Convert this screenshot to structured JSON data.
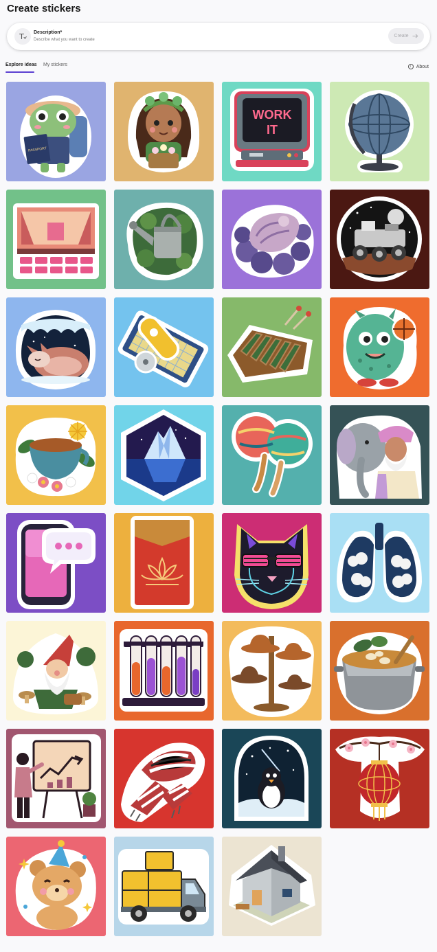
{
  "header": {
    "title": "Create stickers"
  },
  "prompt": {
    "label": "Description*",
    "placeholder": "Describe what you want to create",
    "create_label": "Create"
  },
  "tabs": [
    {
      "label": "Explore ideas",
      "active": true
    },
    {
      "label": "My stickers",
      "active": false
    }
  ],
  "about": {
    "label": "About"
  },
  "work_it_text": [
    "WORK",
    "IT"
  ],
  "passport_text": "PASSPORT",
  "stickers": [
    {
      "id": "frog-traveler",
      "bg": "#9aa5e2",
      "icon": "frog-traveler-icon"
    },
    {
      "id": "flower-girl",
      "bg": "#e0b46f",
      "icon": "flower-girl-icon"
    },
    {
      "id": "work-it-computer",
      "bg": "#6fd9c4",
      "icon": "retro-computer-icon"
    },
    {
      "id": "globe",
      "bg": "#cde9b4",
      "icon": "globe-icon"
    },
    {
      "id": "theater",
      "bg": "#72c189",
      "icon": "theater-icon"
    },
    {
      "id": "watering-can",
      "bg": "#6eb0ac",
      "icon": "watering-can-icon"
    },
    {
      "id": "seashell",
      "bg": "#9b72d9",
      "icon": "seashell-icon"
    },
    {
      "id": "moon-rover",
      "bg": "#4b1812",
      "icon": "moon-rover-icon"
    },
    {
      "id": "sleeping-fox",
      "bg": "#8eb6ee",
      "icon": "sleeping-fox-icon"
    },
    {
      "id": "rotary-cutter",
      "bg": "#74c3ee",
      "icon": "rotary-cutter-icon"
    },
    {
      "id": "xylophone",
      "bg": "#86b96a",
      "icon": "xylophone-icon"
    },
    {
      "id": "basketball-monster",
      "bg": "#ef6c2e",
      "icon": "monster-icon"
    },
    {
      "id": "tea-cup",
      "bg": "#f2c04a",
      "icon": "tea-cup-icon"
    },
    {
      "id": "iceberg",
      "bg": "#71d4e9",
      "icon": "iceberg-icon"
    },
    {
      "id": "maracas",
      "bg": "#54b0ad",
      "icon": "maracas-icon"
    },
    {
      "id": "elephant-man",
      "bg": "#355256",
      "icon": "elephant-icon"
    },
    {
      "id": "phone-chat",
      "bg": "#7c4ec5",
      "icon": "phone-chat-icon"
    },
    {
      "id": "red-envelope",
      "bg": "#edb03e",
      "icon": "red-envelope-icon"
    },
    {
      "id": "neon-cat",
      "bg": "#cc2d74",
      "icon": "cat-icon"
    },
    {
      "id": "cloud-lungs",
      "bg": "#a9dff4",
      "icon": "lungs-icon"
    },
    {
      "id": "gnome",
      "bg": "#fcf5d7",
      "icon": "gnome-icon"
    },
    {
      "id": "test-tubes",
      "bg": "#e8672d",
      "icon": "test-tubes-icon"
    },
    {
      "id": "hat-rack",
      "bg": "#f3bb5c",
      "icon": "hat-rack-icon"
    },
    {
      "id": "soup-pot",
      "bg": "#d9702d",
      "icon": "soup-pot-icon"
    },
    {
      "id": "presentation",
      "bg": "#a1566f",
      "icon": "presentation-icon"
    },
    {
      "id": "scarf",
      "bg": "#d7352e",
      "icon": "scarf-icon"
    },
    {
      "id": "penguin-night",
      "bg": "#1a4657",
      "icon": "penguin-icon"
    },
    {
      "id": "lantern",
      "bg": "#b53024",
      "icon": "lantern-icon"
    },
    {
      "id": "party-bear",
      "bg": "#ec6672",
      "icon": "bear-icon"
    },
    {
      "id": "delivery-truck",
      "bg": "#b7d6e9",
      "icon": "truck-icon"
    },
    {
      "id": "house",
      "bg": "#ece4d2",
      "icon": "house-icon"
    }
  ]
}
